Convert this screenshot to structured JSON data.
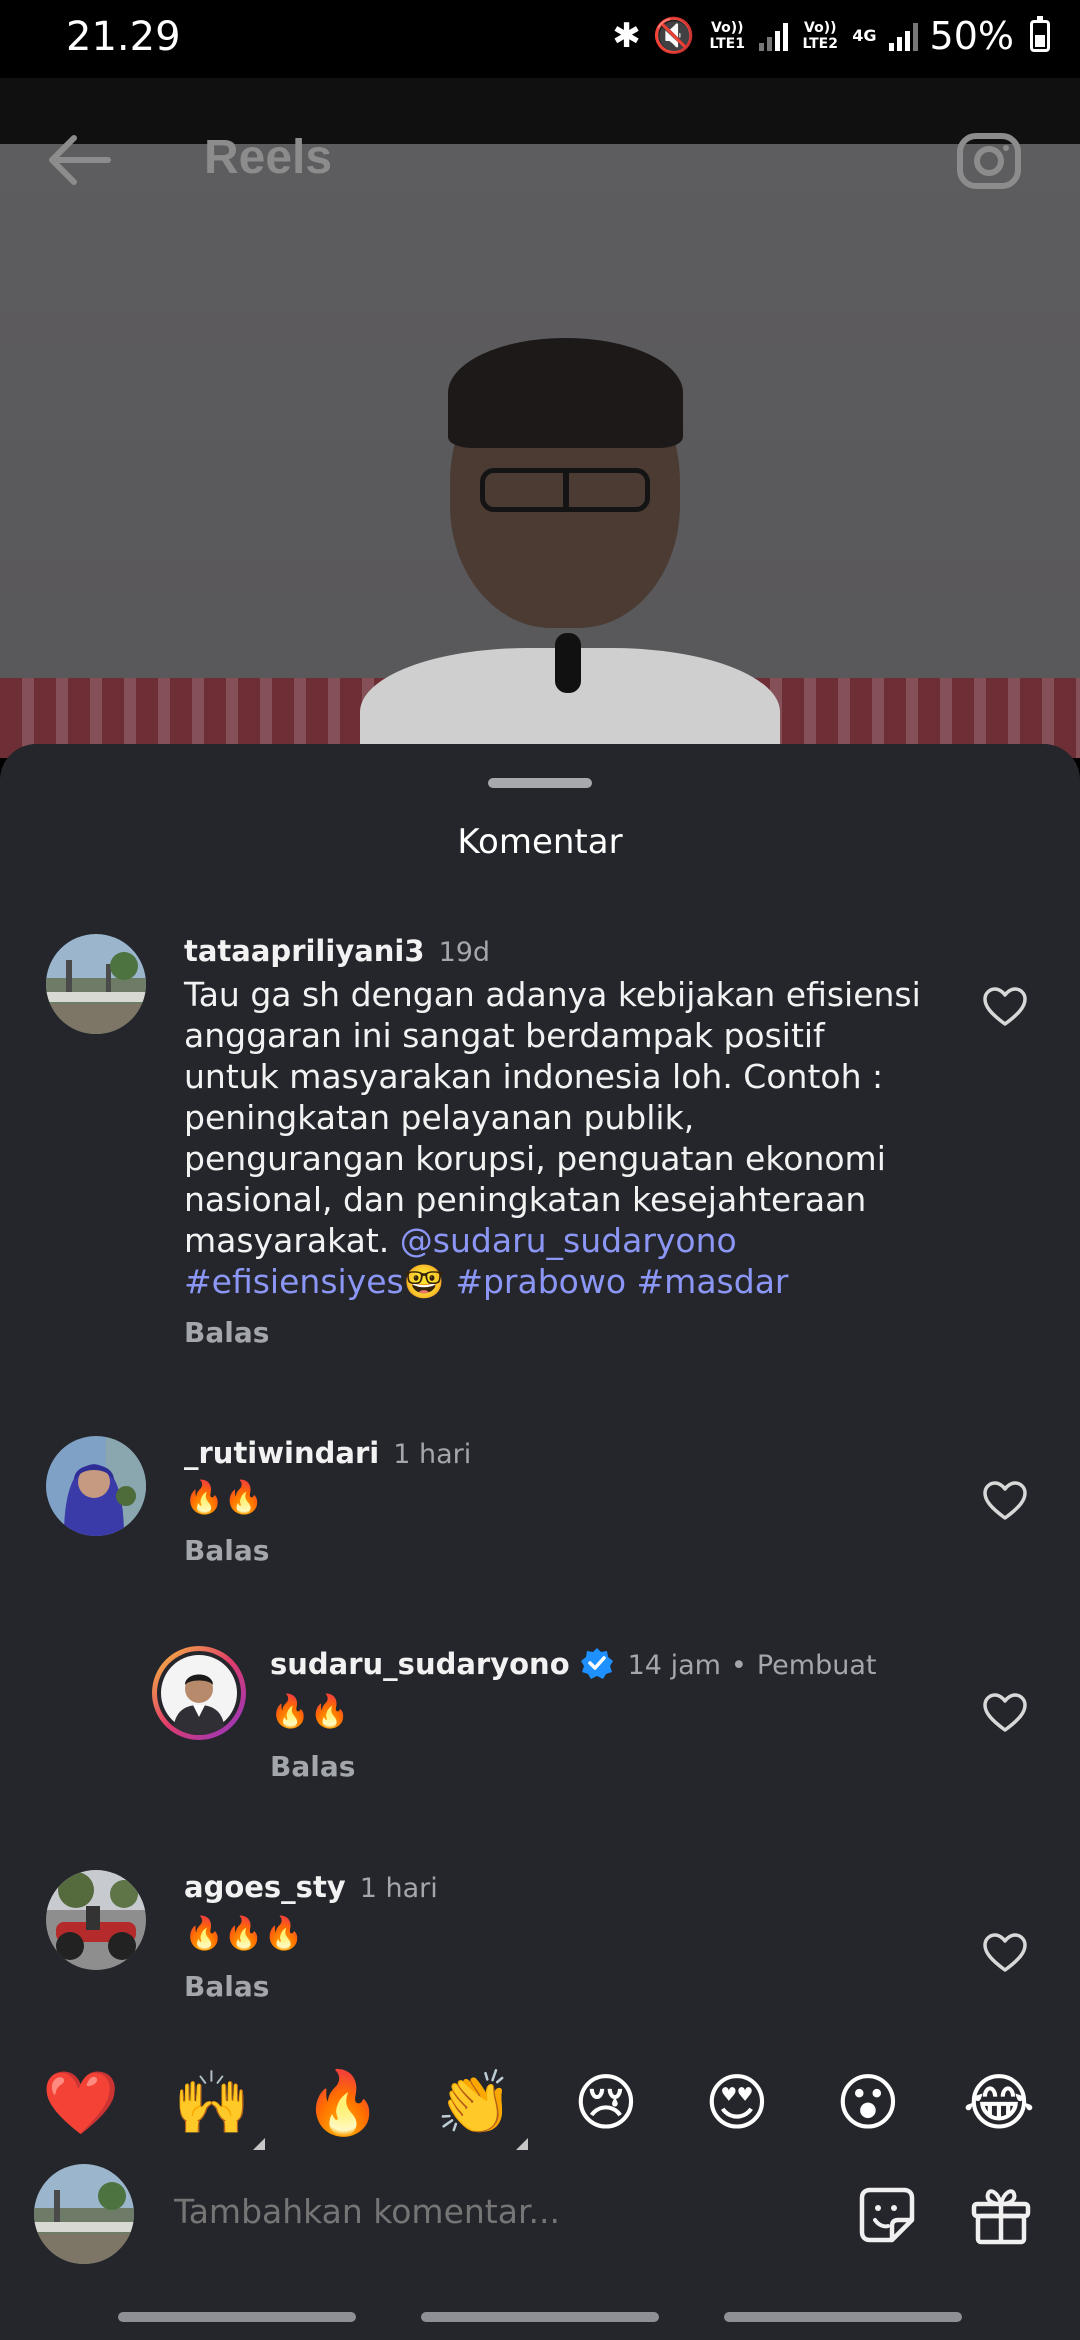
{
  "status_bar": {
    "time": "21.29",
    "sim1": "Vo)) LTE1",
    "sim2": "Vo)) LTE2",
    "net": "4G",
    "battery": "50%"
  },
  "header": {
    "title": "Reels"
  },
  "sheet": {
    "title": "Komentar"
  },
  "comments": [
    {
      "username": "tataapriliyani3",
      "time": "19d",
      "text": "Tau ga sh dengan adanya kebijakan efisiensi anggaran ini sangat berdampak positif untuk masyarakan indonesia loh. Contoh : peningkatan pelayanan publik, pengurangan korupsi, penguatan ekonomi nasional, dan peningkatan kesejahteraan masyarakat.",
      "mention": "@sudaru_sudaryono",
      "hashtag1": "#efisiensiyes",
      "emoji": "🤓",
      "hashtag2": "#prabowo",
      "hashtag3": "#masdar",
      "reply": "Balas"
    },
    {
      "username": "_rutiwindari",
      "time": "1 hari",
      "text": "🔥🔥",
      "reply": "Balas"
    },
    {
      "username": "sudaru_sudaryono",
      "time": "14 jam",
      "creator": "Pembuat",
      "text": "🔥🔥",
      "reply": "Balas"
    },
    {
      "username": "agoes_sty",
      "time": "1 hari",
      "text": "🔥🔥🔥",
      "reply": "Balas"
    }
  ],
  "reactions": [
    "❤️",
    "🙌",
    "🔥",
    "👏",
    "😢",
    "😍",
    "😮",
    "😂"
  ],
  "input": {
    "placeholder": "Tambahkan komentar..."
  },
  "colors": {
    "sheet_bg": "#24262b",
    "link": "#8b96f5",
    "muted": "#a3a6ab"
  }
}
